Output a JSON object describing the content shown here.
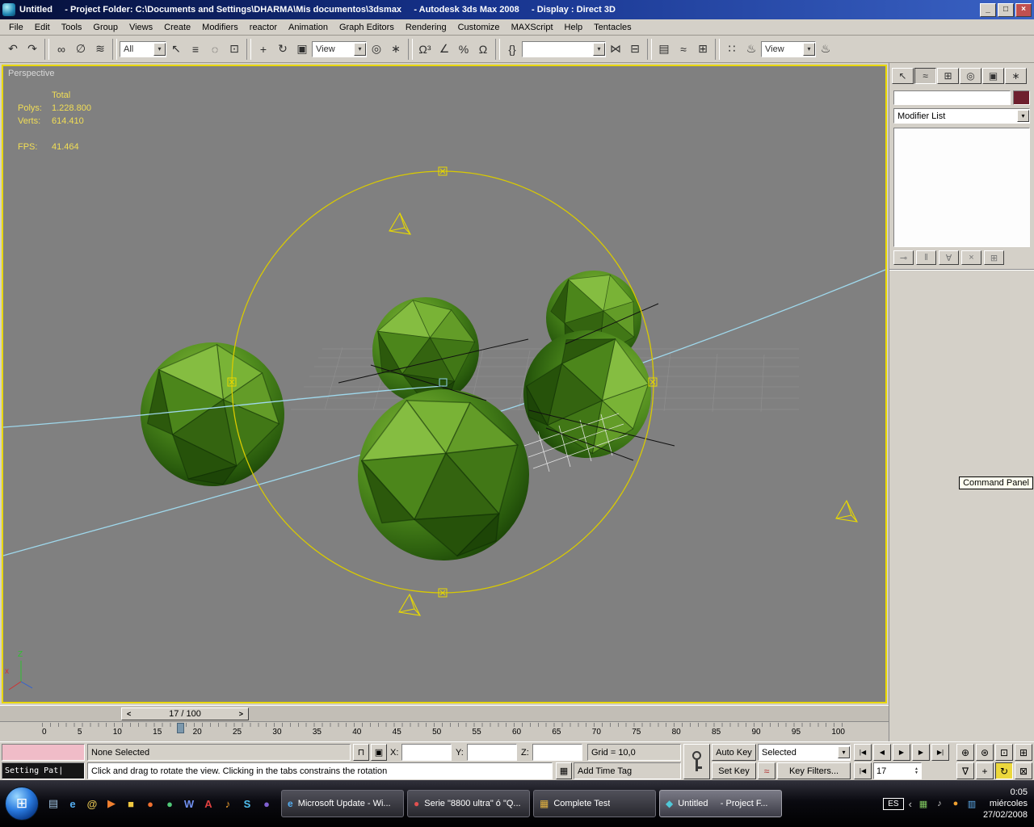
{
  "titlebar": {
    "title": "Untitled     - Project Folder: C:\\Documents and Settings\\DHARMA\\Mis documentos\\3dsmax     - Autodesk 3ds Max 2008     - Display : Direct 3D",
    "minimize_glyph": "_",
    "restore_glyph": "□",
    "close_glyph": "×"
  },
  "menubar": {
    "items": [
      {
        "name": "menu-file",
        "label": "File"
      },
      {
        "name": "menu-edit",
        "label": "Edit"
      },
      {
        "name": "menu-tools",
        "label": "Tools"
      },
      {
        "name": "menu-group",
        "label": "Group"
      },
      {
        "name": "menu-views",
        "label": "Views"
      },
      {
        "name": "menu-create",
        "label": "Create"
      },
      {
        "name": "menu-modifiers",
        "label": "Modifiers"
      },
      {
        "name": "menu-reactor",
        "label": "reactor"
      },
      {
        "name": "menu-animation",
        "label": "Animation"
      },
      {
        "name": "menu-graph-editors",
        "label": "Graph Editors"
      },
      {
        "name": "menu-rendering",
        "label": "Rendering"
      },
      {
        "name": "menu-customize",
        "label": "Customize"
      },
      {
        "name": "menu-maxscript",
        "label": "MAXScript"
      },
      {
        "name": "menu-help",
        "label": "Help"
      },
      {
        "name": "menu-tentacles",
        "label": "Tentacles"
      }
    ]
  },
  "toolbar": {
    "items": [
      {
        "name": "undo-icon",
        "glyph": "↶"
      },
      {
        "name": "redo-icon",
        "glyph": "↷"
      },
      {
        "name": "toolbar-separator",
        "cls": "sep"
      },
      {
        "name": "select-and-link-icon",
        "glyph": "∞"
      },
      {
        "name": "unlink-selection-icon",
        "glyph": "∅"
      },
      {
        "name": "bind-to-space-warp-icon",
        "glyph": "≋"
      },
      {
        "name": "toolbar-separator",
        "cls": "sep"
      },
      {
        "name": "selection-filter-dropdown",
        "label": "All",
        "arrow": "▾",
        "cls": "dd w56"
      },
      {
        "name": "select-object-icon",
        "glyph": "↖"
      },
      {
        "name": "select-by-name-icon",
        "glyph": "≡"
      },
      {
        "name": "selection-region-icon",
        "glyph": "◌"
      },
      {
        "name": "window-crossing-icon",
        "glyph": "⊡"
      },
      {
        "name": "toolbar-separator",
        "cls": "sep"
      },
      {
        "name": "select-and-move-icon",
        "glyph": "+"
      },
      {
        "name": "select-and-rotate-icon",
        "glyph": "↻"
      },
      {
        "name": "select-and-scale-icon",
        "glyph": "▣"
      },
      {
        "name": "reference-coordinate-dropdown",
        "label": "View",
        "arrow": "▾",
        "cls": "dd w66"
      },
      {
        "name": "use-pivot-center-icon",
        "glyph": "◎"
      },
      {
        "name": "select-and-manipulate-icon",
        "glyph": "∗"
      },
      {
        "name": "toolbar-separator",
        "cls": "sep"
      },
      {
        "name": "snap-toggle-3d-icon",
        "glyph": "Ω³"
      },
      {
        "name": "angle-snap-icon",
        "glyph": "∠"
      },
      {
        "name": "percent-snap-icon",
        "glyph": "%"
      },
      {
        "name": "spinner-snap-icon",
        "glyph": "Ω"
      },
      {
        "name": "toolbar-separator",
        "cls": "sep"
      },
      {
        "name": "named-selection-sets-icon",
        "glyph": "{}"
      },
      {
        "name": "named-selection-dropdown",
        "label": "",
        "arrow": "▾",
        "cls": "dd w104"
      },
      {
        "name": "mirror-icon",
        "glyph": "⋈"
      },
      {
        "name": "align-icon",
        "glyph": "⊟"
      },
      {
        "name": "toolbar-separator",
        "cls": "sep"
      },
      {
        "name": "layer-manager-icon",
        "glyph": "▤"
      },
      {
        "name": "curve-editor-icon",
        "glyph": "≈"
      },
      {
        "name": "schematic-view-icon",
        "glyph": "⊞"
      },
      {
        "name": "toolbar-separator",
        "cls": "sep"
      },
      {
        "name": "material-editor-icon",
        "glyph": "∷"
      },
      {
        "name": "render-setup-icon",
        "glyph": "♨"
      },
      {
        "name": "render-preset-dropdown",
        "label": "View",
        "arrow": "▾",
        "cls": "dd w66"
      },
      {
        "name": "quick-render-icon",
        "glyph": "♨"
      }
    ]
  },
  "viewport": {
    "label": "Perspective",
    "stats": {
      "total_label": "Total",
      "polys_label": "Polys:",
      "polys_value": "1.228.800",
      "verts_label": "Verts:",
      "verts_value": "614.410",
      "fps_label": "FPS:",
      "fps_value": "41.464"
    },
    "axis": {
      "x": "x",
      "z": "Z"
    }
  },
  "command_panel": {
    "tabs": [
      {
        "name": "tab-create-icon",
        "glyph": "↖"
      },
      {
        "name": "tab-modify-icon",
        "glyph": "≈",
        "cls": "active"
      },
      {
        "name": "tab-hierarchy-icon",
        "glyph": "⊞"
      },
      {
        "name": "tab-motion-icon",
        "glyph": "◎"
      },
      {
        "name": "tab-display-icon",
        "glyph": "▣"
      },
      {
        "name": "tab-utilities-icon",
        "glyph": "∗"
      }
    ],
    "object_name_value": "",
    "modifier_list_label": "Modifier List",
    "dropdown_arrow": "▾",
    "stack_buttons": [
      {
        "name": "pin-stack-icon",
        "glyph": "⊸"
      },
      {
        "name": "show-end-result-icon",
        "glyph": "‖"
      },
      {
        "name": "make-unique-icon",
        "glyph": "∀"
      },
      {
        "name": "remove-modifier-icon",
        "glyph": "×"
      },
      {
        "name": "configure-modifier-sets-icon",
        "glyph": "⊞"
      }
    ],
    "tooltip": "Command Panel"
  },
  "timeline": {
    "slider_label": "17 / 100",
    "prev_arrow": "<",
    "next_arrow": ">",
    "ruler": [
      "0",
      "5",
      "10",
      "15",
      "20",
      "25",
      "30",
      "35",
      "40",
      "45",
      "50",
      "55",
      "60",
      "65",
      "70",
      "75",
      "80",
      "85",
      "90",
      "95",
      "100"
    ]
  },
  "status_bar": {
    "listener_text": "Setting Pat|",
    "selection_status": "None Selected",
    "lock_glyph": "⊓",
    "abs_offset_glyph": "▣",
    "x_label": "X:",
    "y_label": "Y:",
    "z_label": "Z:",
    "coord_x": "",
    "coord_y": "",
    "coord_z": "",
    "grid_status": "Grid = 10,0",
    "prompt": "Click and drag to rotate the view.  Clicking in the tabs constrains the rotation",
    "comm_glyph": "▦",
    "time_tag": "Add Time Tag",
    "auto_key": "Auto Key",
    "set_key": "Set Key",
    "selected_dropdown": "Selected",
    "dropdown_arrow": "▾",
    "curve_glyph": "≈",
    "key_filters": "Key Filters...",
    "frame_value": "17",
    "spinner_up": "▲",
    "spinner_down": "▼",
    "playback": {
      "go_start": "|◀",
      "prev": "◀",
      "play": "▶",
      "next": "▶",
      "go_end": "▶|",
      "key_mode": "|◀"
    },
    "nav": {
      "zoom": "⊕",
      "zoom_all": "⊛",
      "zoom_extents": "⊡",
      "zoom_extents_all": "⊞",
      "fov": "∇",
      "pan": "+",
      "arc_rotate": "↻",
      "min_max": "⊠"
    }
  },
  "taskbar": {
    "start_glyph": "⊞",
    "quick_launch": [
      {
        "name": "show-desktop-icon",
        "glyph": "▤",
        "color": "#9fc2e0"
      },
      {
        "name": "internet-explorer-icon",
        "glyph": "e",
        "color": "#54aef2"
      },
      {
        "name": "email-icon",
        "glyph": "@",
        "color": "#e0c050"
      },
      {
        "name": "media-player-icon",
        "glyph": "▶",
        "color": "#f08030"
      },
      {
        "name": "folder-icon",
        "glyph": "■",
        "color": "#f0c840"
      },
      {
        "name": "firefox-icon",
        "glyph": "●",
        "color": "#f07030"
      },
      {
        "name": "messenger-icon",
        "glyph": "●",
        "color": "#50c878"
      },
      {
        "name": "word-icon",
        "glyph": "W",
        "color": "#7090f0"
      },
      {
        "name": "acrobat-icon",
        "glyph": "A",
        "color": "#e04040"
      },
      {
        "name": "music-icon",
        "glyph": "♪",
        "color": "#f0a030"
      },
      {
        "name": "skype-icon",
        "glyph": "S",
        "color": "#50c0f0"
      },
      {
        "name": "browser-icon",
        "glyph": "●",
        "color": "#8060d0"
      }
    ],
    "tasks": [
      {
        "name": "task-microsoft-update",
        "label": "Microsoft Update - Wi...",
        "glyph": "e",
        "color": "#54aef2"
      },
      {
        "name": "task-serie-8800-ultra",
        "label": "Serie \"8800 ultra\" ó \"Q...",
        "glyph": "●",
        "color": "#e05050"
      },
      {
        "name": "task-complete-test",
        "label": "Complete Test",
        "glyph": "▦",
        "color": "#e0b040"
      },
      {
        "name": "task-untitled-project",
        "label": "Untitled     - Project F...",
        "glyph": "◆",
        "color": "#50c8d8",
        "cls": "active"
      }
    ],
    "tray": {
      "language": "ES",
      "chevron": "‹",
      "icons": [
        {
          "name": "display-settings-icon",
          "glyph": "▦",
          "color": "#80c860"
        },
        {
          "name": "volume-icon",
          "glyph": "♪",
          "color": "#d0d0d0"
        },
        {
          "name": "update-icon",
          "glyph": "●",
          "color": "#f0a030"
        },
        {
          "name": "network-icon",
          "glyph": "▥",
          "color": "#60b0f0"
        }
      ],
      "time": "0:05",
      "weekday": "miércoles",
      "date": "27/02/2008"
    }
  }
}
